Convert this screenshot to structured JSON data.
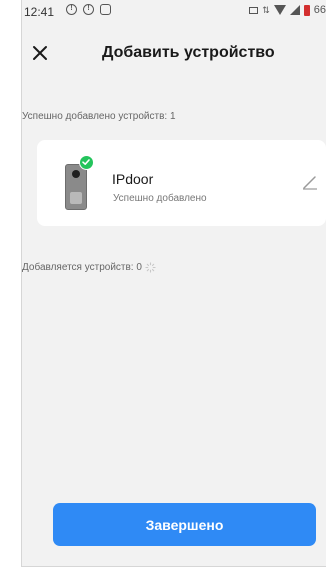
{
  "status_bar": {
    "time": "12:41",
    "battery_level": "66"
  },
  "header": {
    "title": "Добавить устройство"
  },
  "added_section": {
    "label": "Успешно добавлено устройств: 1"
  },
  "device": {
    "name": "IPdoor",
    "status": "Успешно добавлено"
  },
  "adding_section": {
    "label": "Добавляется устройств: 0"
  },
  "footer": {
    "done_label": "Завершено"
  },
  "colors": {
    "accent": "#2f8af5",
    "success": "#24c45c",
    "background": "#f2f2f2",
    "card": "#ffffff"
  },
  "icons": {
    "close": "close-icon",
    "edit": "pencil-icon",
    "check": "check-icon",
    "spinner": "spinner-icon"
  }
}
